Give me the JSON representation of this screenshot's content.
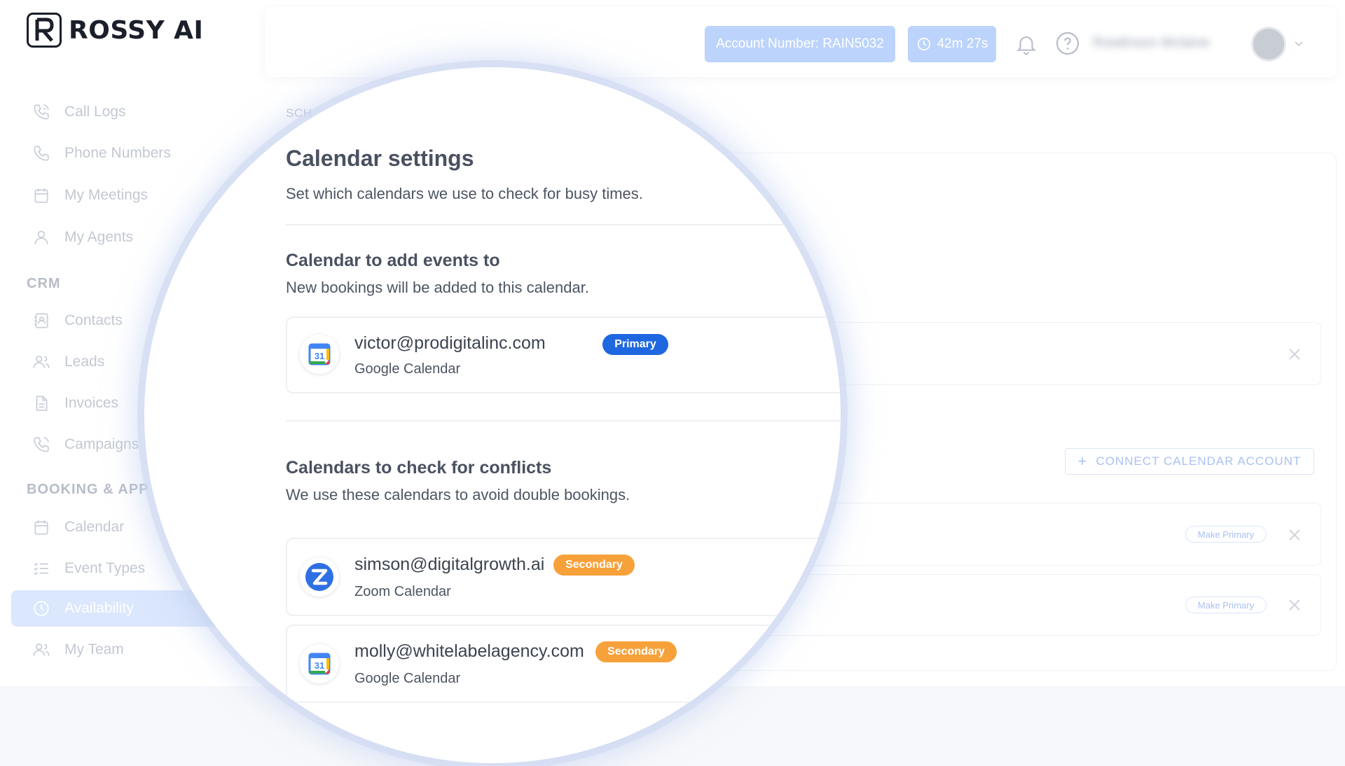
{
  "brand": {
    "name": "ROSSY AI"
  },
  "sidebar": {
    "items": [
      {
        "label": "Call Logs",
        "icon": "phone-call-icon"
      },
      {
        "label": "Phone Numbers",
        "icon": "phone-icon"
      },
      {
        "label": "My Meetings",
        "icon": "calendar-icon"
      },
      {
        "label": "My Agents",
        "icon": "user-icon"
      }
    ],
    "crm_section": "CRM",
    "crm_items": [
      {
        "label": "Contacts",
        "icon": "contact-book-icon"
      },
      {
        "label": "Leads",
        "icon": "users-icon"
      },
      {
        "label": "Invoices",
        "icon": "document-icon"
      },
      {
        "label": "Campaigns",
        "icon": "phone-call-icon"
      }
    ],
    "booking_section": "BOOKING & APP",
    "booking_items": [
      {
        "label": "Calendar",
        "icon": "calendar-icon"
      },
      {
        "label": "Event Types",
        "icon": "checklist-icon"
      },
      {
        "label": "Availability",
        "icon": "clock-icon",
        "active": true
      },
      {
        "label": "My Team",
        "icon": "users-icon"
      }
    ]
  },
  "header": {
    "account_number": "Account Number: RAIN5032",
    "timer": "42m 27s",
    "user_name": "Rowlinson Mclaine"
  },
  "main": {
    "tab_partial": "SCH",
    "connect_button": "CONNECT CALENDAR ACCOUNT",
    "make_primary_label": "Make Primary"
  },
  "calendar_settings": {
    "title": "Calendar settings",
    "subtitle": "Set which calendars we use to check for busy times.",
    "add_events": {
      "heading": "Calendar to add events to",
      "description": "New bookings will be added to this calendar.",
      "account": {
        "email": "victor@prodigitalinc.com",
        "provider": "Google Calendar",
        "badge": "Primary"
      }
    },
    "conflicts": {
      "heading": "Calendars to check for conflicts",
      "description": "We use these calendars to avoid double bookings.",
      "accounts": [
        {
          "email": "simson@digitalgrowth.ai",
          "provider": "Zoom Calendar",
          "badge": "Secondary"
        },
        {
          "email": "molly@whitelabelagency.com",
          "provider": "Google Calendar",
          "badge": "Secondary"
        }
      ]
    }
  },
  "colors": {
    "accent": "#1f67e0",
    "secondary": "#f7a13a",
    "active_nav": "#dbe7fd"
  }
}
